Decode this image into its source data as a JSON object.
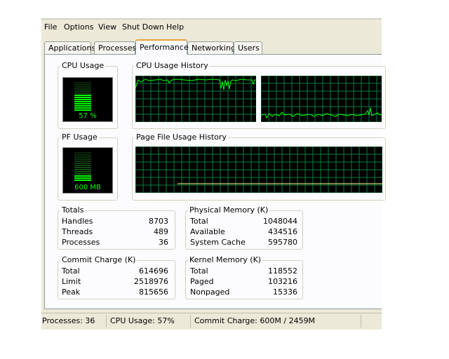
{
  "menu": [
    "File",
    "Options",
    "View",
    "Shut Down",
    "Help"
  ],
  "tabs": [
    "Applications",
    "Processes",
    "Performance",
    "Networking",
    "Users"
  ],
  "active_tab": "Performance",
  "cpu_usage": {
    "label": "CPU Usage",
    "value_text": "57 %",
    "level": 0.57
  },
  "cpu_history": {
    "label": "CPU Usage History"
  },
  "pf_usage": {
    "label": "PF Usage",
    "value_text": "600 MB",
    "level": 0.24
  },
  "pf_history": {
    "label": "Page File Usage History"
  },
  "totals": {
    "label": "Totals",
    "rows": [
      {
        "name": "Handles",
        "value": "8703"
      },
      {
        "name": "Threads",
        "value": "489"
      },
      {
        "name": "Processes",
        "value": "36"
      }
    ]
  },
  "physical_memory": {
    "label": "Physical Memory (K)",
    "rows": [
      {
        "name": "Total",
        "value": "1048044"
      },
      {
        "name": "Available",
        "value": "434516"
      },
      {
        "name": "System Cache",
        "value": "595780"
      }
    ]
  },
  "commit_charge": {
    "label": "Commit Charge (K)",
    "rows": [
      {
        "name": "Total",
        "value": "614696"
      },
      {
        "name": "Limit",
        "value": "2518976"
      },
      {
        "name": "Peak",
        "value": "815656"
      }
    ]
  },
  "kernel_memory": {
    "label": "Kernel Memory (K)",
    "rows": [
      {
        "name": "Total",
        "value": "118552"
      },
      {
        "name": "Paged",
        "value": "103216"
      },
      {
        "name": "Nonpaged",
        "value": "15336"
      }
    ]
  },
  "status": {
    "processes": "Processes: 36",
    "cpu": "CPU Usage: 57%",
    "commit": "Commit Charge: 600M / 2459M"
  },
  "colors": {
    "grid": "#008040",
    "trace": "#00ff00",
    "accent": "#e5a23a"
  }
}
